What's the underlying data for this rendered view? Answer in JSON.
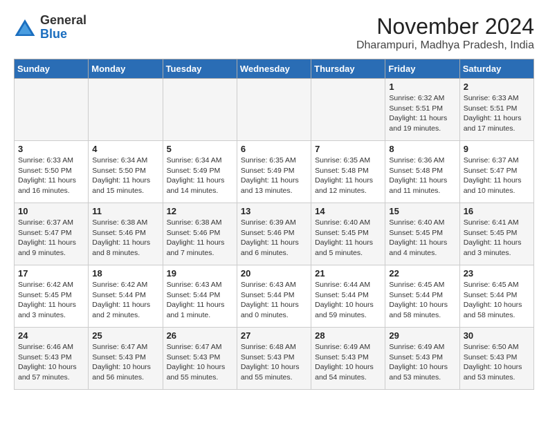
{
  "logo": {
    "general": "General",
    "blue": "Blue"
  },
  "title": "November 2024",
  "subtitle": "Dharampuri, Madhya Pradesh, India",
  "headers": [
    "Sunday",
    "Monday",
    "Tuesday",
    "Wednesday",
    "Thursday",
    "Friday",
    "Saturday"
  ],
  "weeks": [
    [
      {
        "day": "",
        "info": ""
      },
      {
        "day": "",
        "info": ""
      },
      {
        "day": "",
        "info": ""
      },
      {
        "day": "",
        "info": ""
      },
      {
        "day": "",
        "info": ""
      },
      {
        "day": "1",
        "info": "Sunrise: 6:32 AM\nSunset: 5:51 PM\nDaylight: 11 hours and 19 minutes."
      },
      {
        "day": "2",
        "info": "Sunrise: 6:33 AM\nSunset: 5:51 PM\nDaylight: 11 hours and 17 minutes."
      }
    ],
    [
      {
        "day": "3",
        "info": "Sunrise: 6:33 AM\nSunset: 5:50 PM\nDaylight: 11 hours and 16 minutes."
      },
      {
        "day": "4",
        "info": "Sunrise: 6:34 AM\nSunset: 5:50 PM\nDaylight: 11 hours and 15 minutes."
      },
      {
        "day": "5",
        "info": "Sunrise: 6:34 AM\nSunset: 5:49 PM\nDaylight: 11 hours and 14 minutes."
      },
      {
        "day": "6",
        "info": "Sunrise: 6:35 AM\nSunset: 5:49 PM\nDaylight: 11 hours and 13 minutes."
      },
      {
        "day": "7",
        "info": "Sunrise: 6:35 AM\nSunset: 5:48 PM\nDaylight: 11 hours and 12 minutes."
      },
      {
        "day": "8",
        "info": "Sunrise: 6:36 AM\nSunset: 5:48 PM\nDaylight: 11 hours and 11 minutes."
      },
      {
        "day": "9",
        "info": "Sunrise: 6:37 AM\nSunset: 5:47 PM\nDaylight: 11 hours and 10 minutes."
      }
    ],
    [
      {
        "day": "10",
        "info": "Sunrise: 6:37 AM\nSunset: 5:47 PM\nDaylight: 11 hours and 9 minutes."
      },
      {
        "day": "11",
        "info": "Sunrise: 6:38 AM\nSunset: 5:46 PM\nDaylight: 11 hours and 8 minutes."
      },
      {
        "day": "12",
        "info": "Sunrise: 6:38 AM\nSunset: 5:46 PM\nDaylight: 11 hours and 7 minutes."
      },
      {
        "day": "13",
        "info": "Sunrise: 6:39 AM\nSunset: 5:46 PM\nDaylight: 11 hours and 6 minutes."
      },
      {
        "day": "14",
        "info": "Sunrise: 6:40 AM\nSunset: 5:45 PM\nDaylight: 11 hours and 5 minutes."
      },
      {
        "day": "15",
        "info": "Sunrise: 6:40 AM\nSunset: 5:45 PM\nDaylight: 11 hours and 4 minutes."
      },
      {
        "day": "16",
        "info": "Sunrise: 6:41 AM\nSunset: 5:45 PM\nDaylight: 11 hours and 3 minutes."
      }
    ],
    [
      {
        "day": "17",
        "info": "Sunrise: 6:42 AM\nSunset: 5:45 PM\nDaylight: 11 hours and 3 minutes."
      },
      {
        "day": "18",
        "info": "Sunrise: 6:42 AM\nSunset: 5:44 PM\nDaylight: 11 hours and 2 minutes."
      },
      {
        "day": "19",
        "info": "Sunrise: 6:43 AM\nSunset: 5:44 PM\nDaylight: 11 hours and 1 minute."
      },
      {
        "day": "20",
        "info": "Sunrise: 6:43 AM\nSunset: 5:44 PM\nDaylight: 11 hours and 0 minutes."
      },
      {
        "day": "21",
        "info": "Sunrise: 6:44 AM\nSunset: 5:44 PM\nDaylight: 10 hours and 59 minutes."
      },
      {
        "day": "22",
        "info": "Sunrise: 6:45 AM\nSunset: 5:44 PM\nDaylight: 10 hours and 58 minutes."
      },
      {
        "day": "23",
        "info": "Sunrise: 6:45 AM\nSunset: 5:44 PM\nDaylight: 10 hours and 58 minutes."
      }
    ],
    [
      {
        "day": "24",
        "info": "Sunrise: 6:46 AM\nSunset: 5:43 PM\nDaylight: 10 hours and 57 minutes."
      },
      {
        "day": "25",
        "info": "Sunrise: 6:47 AM\nSunset: 5:43 PM\nDaylight: 10 hours and 56 minutes."
      },
      {
        "day": "26",
        "info": "Sunrise: 6:47 AM\nSunset: 5:43 PM\nDaylight: 10 hours and 55 minutes."
      },
      {
        "day": "27",
        "info": "Sunrise: 6:48 AM\nSunset: 5:43 PM\nDaylight: 10 hours and 55 minutes."
      },
      {
        "day": "28",
        "info": "Sunrise: 6:49 AM\nSunset: 5:43 PM\nDaylight: 10 hours and 54 minutes."
      },
      {
        "day": "29",
        "info": "Sunrise: 6:49 AM\nSunset: 5:43 PM\nDaylight: 10 hours and 53 minutes."
      },
      {
        "day": "30",
        "info": "Sunrise: 6:50 AM\nSunset: 5:43 PM\nDaylight: 10 hours and 53 minutes."
      }
    ]
  ]
}
